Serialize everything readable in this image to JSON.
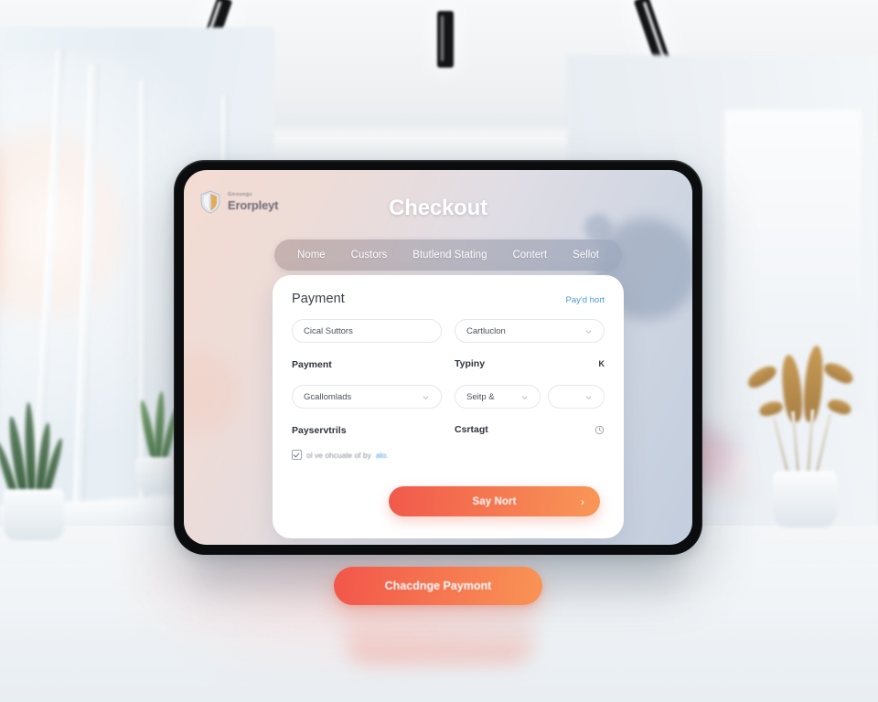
{
  "scene": {
    "description": "Tablet mockup showing a checkout UI in a bright modern interior",
    "ceiling_lights": [
      "ceiling-light-left",
      "ceiling-light-center",
      "ceiling-light-right"
    ],
    "plants": [
      "snake-plant-left",
      "small-plant-left",
      "golden-leaf-plant-right"
    ]
  },
  "device": {
    "type": "tablet",
    "bezel_color": "#0b0c0e"
  },
  "screen": {
    "brand": {
      "tagline": "Gnoungs",
      "name": "Erorpleyt",
      "icon": "shield-badge-icon"
    },
    "title": "Checkout",
    "nav": {
      "items": [
        {
          "label": "Nome"
        },
        {
          "label": "Custors"
        },
        {
          "label": "Btutlend Stating"
        },
        {
          "label": "Contert"
        },
        {
          "label": "Sellot"
        }
      ]
    },
    "card": {
      "title": "Payment",
      "link": "Pay'd hort",
      "row1": {
        "input_value": "Cical Suttors",
        "select_value": "Cartluclon",
        "select_icon": "chevron-down-icon"
      },
      "labels": {
        "left": "Payment",
        "right": "Typiny",
        "right_meta": "K"
      },
      "row2": {
        "select_left": "Gcallomlads",
        "select_mid": "Seitp &",
        "select_right": "",
        "select_icon": "chevron-down-icon"
      },
      "labels2": {
        "left": "Payservtrils",
        "right": "Csrtagt",
        "right_icon": "clock-icon"
      },
      "consent": {
        "checked": true,
        "text": "ol ve ohcuale of by",
        "link": "alo."
      },
      "cta": {
        "label": "Say Nort",
        "arrow_icon": "chevron-right-icon",
        "gradient_from": "#f1594c",
        "gradient_to": "#f99757"
      }
    }
  },
  "outer_button": {
    "label": "Chacdnge Paymont",
    "gradient_from": "#f2564a",
    "gradient_to": "#f99455"
  },
  "colors": {
    "accent_orange": "#f56f4f",
    "accent_blue": "#4a9ad4",
    "screen_gradient_start": "#f3dcd2",
    "screen_gradient_end": "#c3cddd"
  }
}
